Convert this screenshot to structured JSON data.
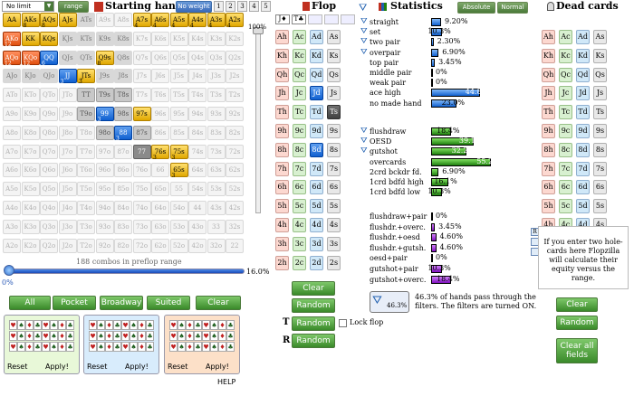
{
  "header": {
    "limit_select": "No limit",
    "range_btn": "range",
    "starting_hand_title": "Starting hand",
    "no_weight_btn": "No weight",
    "weight_tabs": [
      "1",
      "2",
      "3",
      "4",
      "5"
    ],
    "flop_title": "Flop",
    "statistics_title": "Statistics",
    "absolute_btn": "Absolute",
    "normal_btn": "Normal",
    "dead_cards_title": "Dead cards"
  },
  "grid": {
    "rows": [
      [
        "AA",
        "AKs",
        "AQs",
        "AJs",
        "ATs",
        "A9s",
        "A8s",
        "A7s",
        "A6s",
        "A5s",
        "A4s",
        "A3s",
        "A2s"
      ],
      [
        "AKo",
        "KK",
        "KQs",
        "KJs",
        "KTs",
        "K9s",
        "K8s",
        "K7s",
        "K6s",
        "K5s",
        "K4s",
        "K3s",
        "K2s"
      ],
      [
        "AQo",
        "KQo",
        "QQ",
        "QJs",
        "QTs",
        "Q9s",
        "Q8s",
        "Q7s",
        "Q6s",
        "Q5s",
        "Q4s",
        "Q3s",
        "Q2s"
      ],
      [
        "AJo",
        "KJo",
        "QJo",
        "JJ",
        "JTs",
        "J9s",
        "J8s",
        "J7s",
        "J6s",
        "J5s",
        "J4s",
        "J3s",
        "J2s"
      ],
      [
        "ATo",
        "KTo",
        "QTo",
        "JTo",
        "TT",
        "T9s",
        "T8s",
        "T7s",
        "T6s",
        "T5s",
        "T4s",
        "T3s",
        "T2s"
      ],
      [
        "A9o",
        "K9o",
        "Q9o",
        "J9o",
        "T9o",
        "99",
        "98s",
        "97s",
        "96s",
        "95s",
        "94s",
        "93s",
        "92s"
      ],
      [
        "A8o",
        "K8o",
        "Q8o",
        "J8o",
        "T8o",
        "98o",
        "88",
        "87s",
        "86s",
        "85s",
        "84s",
        "83s",
        "82s"
      ],
      [
        "A7o",
        "K7o",
        "Q7o",
        "J7o",
        "T7o",
        "97o",
        "87o",
        "77",
        "76s",
        "75s",
        "74s",
        "73s",
        "72s"
      ],
      [
        "A6o",
        "K6o",
        "Q6o",
        "J6o",
        "T6o",
        "96o",
        "86o",
        "76o",
        "66",
        "65s",
        "64s",
        "63s",
        "62s"
      ],
      [
        "A5o",
        "K5o",
        "Q5o",
        "J5o",
        "T5o",
        "95o",
        "85o",
        "75o",
        "65o",
        "55",
        "54s",
        "53s",
        "52s"
      ],
      [
        "A4o",
        "K4o",
        "Q4o",
        "J4o",
        "T4o",
        "94o",
        "84o",
        "74o",
        "64o",
        "54o",
        "44",
        "43s",
        "42s"
      ],
      [
        "A3o",
        "K3o",
        "Q3o",
        "J3o",
        "T3o",
        "93o",
        "83o",
        "73o",
        "63o",
        "53o",
        "43o",
        "33",
        "32s"
      ],
      [
        "A2o",
        "K2o",
        "Q2o",
        "J2o",
        "T2o",
        "92o",
        "82o",
        "72o",
        "62o",
        "52o",
        "42o",
        "32o",
        "22"
      ]
    ],
    "badges": {
      "AKs": "8",
      "AQs": "8",
      "AKo": "12",
      "AQo": "12",
      "KQo": "12",
      "A7s": "4",
      "A6s": "4",
      "A5s": "4",
      "A4s": "4",
      "A3s": "4",
      "A2s": "4",
      "QQ": "6",
      "JJ": "3",
      "JTs": "3",
      "Q9s": "8",
      "99": "3",
      "88": "3",
      "76s": "3",
      "75s": "3",
      "65s": "3"
    },
    "combos_text": "188 combos in preflop range",
    "zoom_top": "100%",
    "zoom_bottom": "16.0%",
    "slider_left": "0%"
  },
  "range_buttons": [
    "All",
    "Pocket",
    "Broadway",
    "Suited",
    "Clear"
  ],
  "boxes": [
    {
      "reset": "Reset",
      "apply": "Apply!"
    },
    {
      "reset": "Reset",
      "apply": "Apply!"
    },
    {
      "reset": "Reset",
      "apply": "Apply!"
    }
  ],
  "help": "HELP",
  "flop": {
    "selected": [
      "J♦",
      "T♣"
    ],
    "rows": [
      [
        "Ah",
        "Ac",
        "Ad",
        "As"
      ],
      [
        "Kh",
        "Kc",
        "Kd",
        "Ks"
      ],
      [
        "Qh",
        "Qc",
        "Qd",
        "Qs"
      ],
      [
        "Jh",
        "Jc",
        "Jd",
        "Js"
      ],
      [
        "Th",
        "Tc",
        "Td",
        "Ts"
      ],
      [
        "9h",
        "9c",
        "9d",
        "9s"
      ],
      [
        "8h",
        "8c",
        "8d",
        "8s"
      ],
      [
        "7h",
        "7c",
        "7d",
        "7s"
      ],
      [
        "6h",
        "6c",
        "6d",
        "6s"
      ],
      [
        "5h",
        "5c",
        "5d",
        "5s"
      ],
      [
        "4h",
        "4c",
        "4d",
        "4s"
      ],
      [
        "3h",
        "3c",
        "3d",
        "3s"
      ],
      [
        "2h",
        "2c",
        "2d",
        "2s"
      ]
    ],
    "clear_btn": "Clear",
    "random_btn": "Random",
    "turn_letter": "T",
    "turn_random": "Random",
    "lock_flop": "Lock flop",
    "river_letter": "R",
    "river_random": "Random"
  },
  "stats": {
    "made": [
      {
        "label": "straight",
        "value": "9.20%",
        "pct": 9.2
      },
      {
        "label": "set",
        "value": "10.3%",
        "pct": 10.3
      },
      {
        "label": "two pair",
        "value": "2.30%",
        "pct": 2.3
      },
      {
        "label": "overpair",
        "value": "6.90%",
        "pct": 6.9
      },
      {
        "label": "top pair",
        "value": "3.45%",
        "pct": 3.45
      },
      {
        "label": "middle pair",
        "value": "0%",
        "pct": 0
      },
      {
        "label": "weak pair",
        "value": "0%",
        "pct": 0
      },
      {
        "label": "ace high",
        "value": "44.8%",
        "pct": 44.8
      },
      {
        "label": "no made hand",
        "value": "23.0%",
        "pct": 23.0
      }
    ],
    "draws": [
      {
        "label": "flushdraw",
        "value": "18.4%",
        "pct": 18.4
      },
      {
        "label": "OESD",
        "value": "39.1%",
        "pct": 39.1
      },
      {
        "label": "gutshot",
        "value": "32.2%",
        "pct": 32.2
      },
      {
        "label": "overcards",
        "value": "55.2%",
        "pct": 55.2
      },
      {
        "label": "2crd bckdr fd.",
        "value": "6.90%",
        "pct": 6.9
      },
      {
        "label": "1crd bdfd high",
        "value": "16.1%",
        "pct": 16.1
      },
      {
        "label": "1crd bdfd low",
        "value": "10.3%",
        "pct": 10.3
      }
    ],
    "combos": [
      {
        "label": "flushdraw+pair",
        "value": "0%",
        "pct": 0
      },
      {
        "label": "flushdr.+overc.",
        "value": "3.45%",
        "pct": 3.45
      },
      {
        "label": "flushdr.+oesd",
        "value": "4.60%",
        "pct": 4.6
      },
      {
        "label": "flushdr.+gutsh.",
        "value": "4.60%",
        "pct": 4.6
      },
      {
        "label": "oesd+pair",
        "value": "0%",
        "pct": 0
      },
      {
        "label": "gutshot+pair",
        "value": "10.3%",
        "pct": 10.3
      },
      {
        "label": "gutshot+overc.",
        "value": "18.4%",
        "pct": 18.4
      }
    ],
    "filter_percent": "46.3%",
    "filter_text": "46.3% of hands pass through the filters. The filters are turned ON."
  },
  "dead": {
    "rows": [
      [
        "Ah",
        "Ac",
        "Ad",
        "As"
      ],
      [
        "Kh",
        "Kc",
        "Kd",
        "Ks"
      ],
      [
        "Qh",
        "Qc",
        "Qd",
        "Qs"
      ],
      [
        "Jh",
        "Jc",
        "Jd",
        "Js"
      ],
      [
        "Th",
        "Tc",
        "Td",
        "Ts"
      ],
      [
        "9h",
        "9c",
        "9d",
        "9s"
      ],
      [
        "8h",
        "8c",
        "8d",
        "8s"
      ],
      [
        "7h",
        "7c",
        "7d",
        "7s"
      ],
      [
        "6h",
        "6c",
        "6d",
        "6s"
      ],
      [
        "5h",
        "5c",
        "5d",
        "5s"
      ],
      [
        "4h",
        "4c",
        "4d",
        "4s"
      ],
      [
        "3h",
        "3c",
        "3d",
        "3s"
      ],
      [
        "2h",
        "2c",
        "2d",
        "2s"
      ]
    ],
    "info": "If you enter two hole-cards here Flopzilla will calculate their equity versus the range.",
    "clear_btn": "Clear",
    "random_btn": "Random",
    "clear_all": "Clear all fields"
  }
}
